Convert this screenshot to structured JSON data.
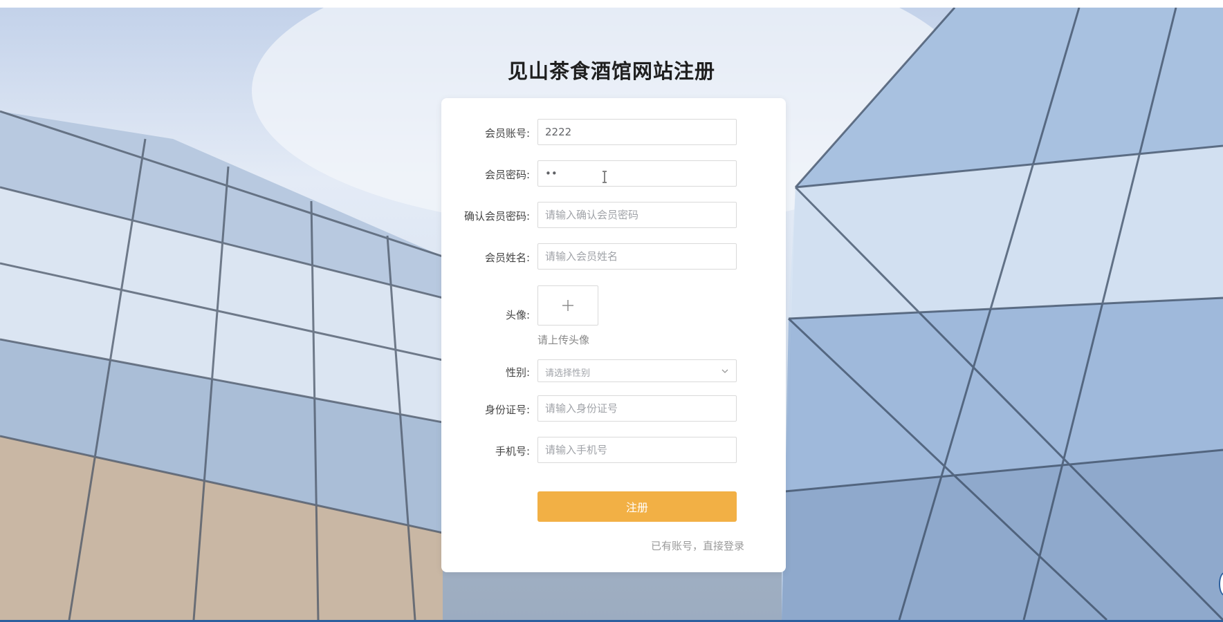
{
  "page": {
    "title": "见山茶食酒馆网站注册"
  },
  "form": {
    "account": {
      "label": "会员账号:",
      "value": "2222",
      "placeholder": "请输入会员账号"
    },
    "password": {
      "label": "会员密码:",
      "value": "••"
    },
    "confirm_password": {
      "label": "确认会员密码:",
      "value": "",
      "placeholder": "请输入确认会员密码"
    },
    "name": {
      "label": "会员姓名:",
      "value": "",
      "placeholder": "请输入会员姓名"
    },
    "avatar": {
      "label": "头像:",
      "hint": "请上传头像",
      "icon": "plus-icon"
    },
    "gender": {
      "label": "性别:",
      "placeholder": "请选择性别",
      "icon": "chevron-down-icon"
    },
    "id_number": {
      "label": "身份证号:",
      "value": "",
      "placeholder": "请输入身份证号"
    },
    "phone": {
      "label": "手机号:",
      "value": "",
      "placeholder": "请输入手机号"
    },
    "submit_label": "注册",
    "login_link": "已有账号，直接登录"
  },
  "colors": {
    "button": "#f2b045",
    "card": "#ffffff",
    "title": "#1f1f1f"
  }
}
